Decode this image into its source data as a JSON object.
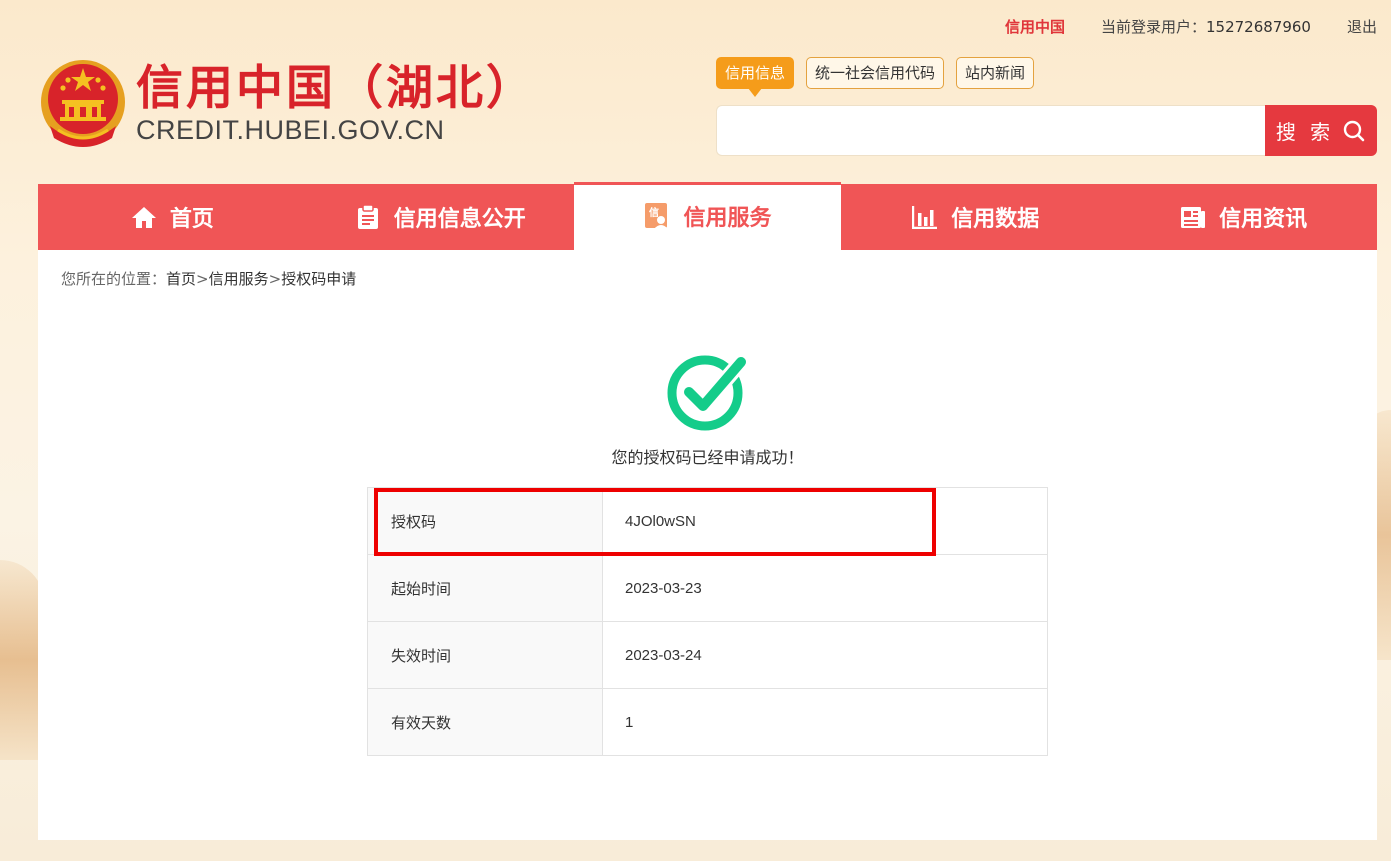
{
  "topbar": {
    "brand_link": "信用中国",
    "user_label": "当前登录用户：",
    "user_phone": "15272687960",
    "logout": "退出"
  },
  "logo": {
    "title": "信用中国（湖北）",
    "domain": "CREDIT.HUBEI.GOV.CN"
  },
  "search": {
    "tabs": [
      "信用信息",
      "统一社会信用代码",
      "站内新闻"
    ],
    "active_tab": 0,
    "input_value": "",
    "button_label": "搜 索"
  },
  "nav": {
    "items": [
      {
        "label": "首页",
        "icon": "home-icon"
      },
      {
        "label": "信用信息公开",
        "icon": "clipboard-icon"
      },
      {
        "label": "信用服务",
        "icon": "credit-service-icon"
      },
      {
        "label": "信用数据",
        "icon": "bar-chart-icon"
      },
      {
        "label": "信用资讯",
        "icon": "newspaper-icon"
      }
    ],
    "active_index": 2
  },
  "breadcrumb": {
    "prefix": "您所在的位置：",
    "items": [
      "首页",
      "信用服务",
      "授权码申请"
    ],
    "separator": ">"
  },
  "result": {
    "message": "您的授权码已经申请成功！",
    "rows": [
      {
        "label": "授权码",
        "value": "4JOl0wSN"
      },
      {
        "label": "起始时间",
        "value": "2023-03-23"
      },
      {
        "label": "失效时间",
        "value": "2023-03-24"
      },
      {
        "label": "有效天数",
        "value": "1"
      }
    ]
  },
  "colors": {
    "brand_red": "#d8232a",
    "nav_red": "#f05556",
    "search_red": "#e5393f",
    "tab_orange": "#f59c1a",
    "success_green": "#14cc8a",
    "highlight_red": "#ee0000"
  }
}
